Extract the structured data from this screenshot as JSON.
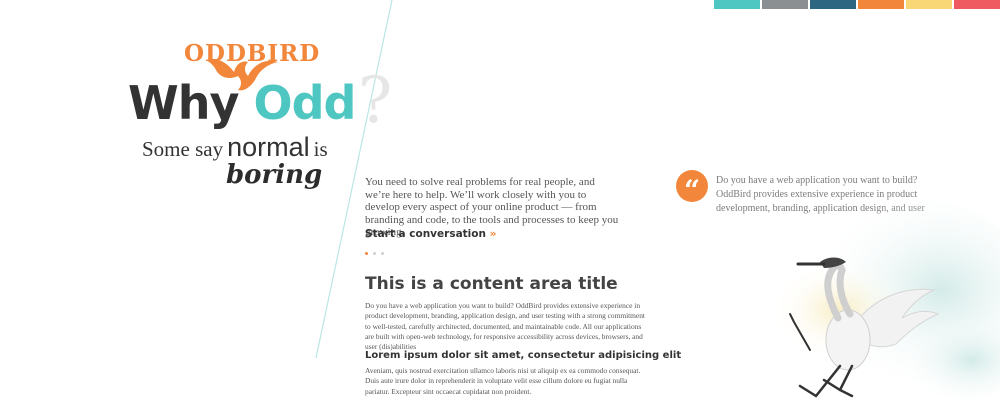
{
  "palette": {
    "stripes": [
      "#4ec6c1",
      "#8c8f91",
      "#2d6680",
      "#f2863a",
      "#f9d777",
      "#ee5a5f"
    ],
    "accent": "#f2863a",
    "teal": "#4ec6c1",
    "divider": "#b9e6e4"
  },
  "logo": {
    "text": "ODDBIRD",
    "icon": "bird-wing-icon"
  },
  "hero": {
    "why": "Why",
    "odd": "Odd",
    "question_mark": "?",
    "tagline": {
      "some_say": "Some say",
      "normal": "normal",
      "is": "is",
      "boring": "boring"
    }
  },
  "intro": {
    "text": "You need to solve real problems for real people, and we’re here to help. We’ll work closely with you to develop every aspect of your online product — from branding and code, to the tools and processes to keep you growing.",
    "cta_label": "Start a conversation",
    "cta_arrow": "»"
  },
  "pager": {
    "count": 3,
    "active_index": 0
  },
  "content": {
    "title": "This is a content area title",
    "body": "Do you have a web application you want to build? OddBird provides extensive experience in product development, branding, application design, and user testing with a strong commitment to well-tested, carefully architected, documented, and maintainable code. All our applications are built with open-web technology, for responsive accessibility across devices, browsers, and user (dis)abilities",
    "subtitle": "Lorem ipsum dolor sit amet, consectetur adipisicing elit",
    "subbody": "Aveniam, quis nostrud exercitation ullamco laboris nisi ut aliquip ex ea commodo consequat. Duis aute irure dolor in reprehenderit in voluptate velit esse cillum dolore eu fugiat nulla pariatur. Excepteur sint occaecat cupidatat non proident."
  },
  "quote": {
    "icon": "quote-mark-icon",
    "mark": "“",
    "text": "Do you have a web application you want to build? OddBird provides extensive experience in product development, branding, application design, and user"
  }
}
